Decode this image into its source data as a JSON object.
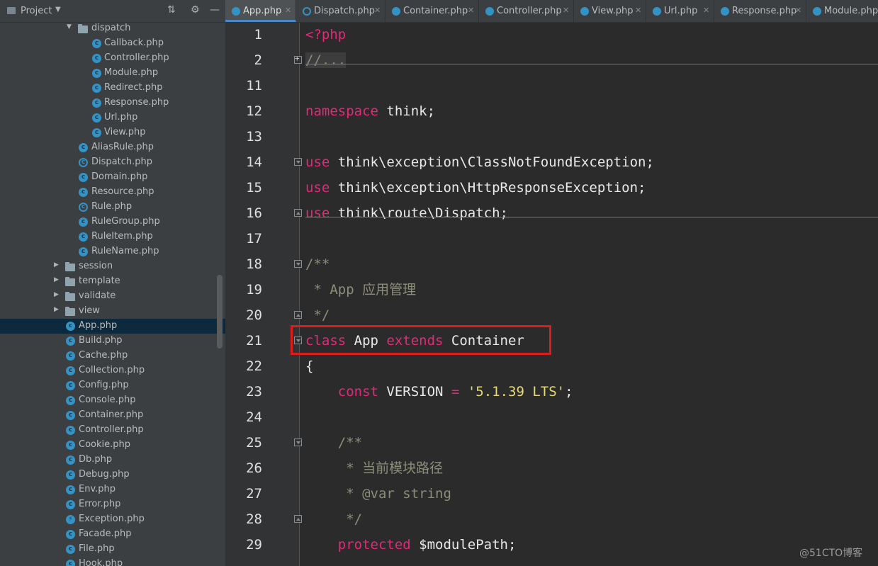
{
  "sidebar": {
    "title": "Project",
    "items": [
      {
        "label": "dispatch",
        "kind": "folder",
        "expanded": true,
        "level": 1
      },
      {
        "label": "Callback.php",
        "kind": "class",
        "level": 2
      },
      {
        "label": "Controller.php",
        "kind": "class",
        "level": 2
      },
      {
        "label": "Module.php",
        "kind": "class",
        "level": 2
      },
      {
        "label": "Redirect.php",
        "kind": "class",
        "level": 2
      },
      {
        "label": "Response.php",
        "kind": "class",
        "level": 2
      },
      {
        "label": "Url.php",
        "kind": "class",
        "level": 2
      },
      {
        "label": "View.php",
        "kind": "class",
        "level": 2
      },
      {
        "label": "AliasRule.php",
        "kind": "class",
        "level": 1
      },
      {
        "label": "Dispatch.php",
        "kind": "abstract",
        "level": 1
      },
      {
        "label": "Domain.php",
        "kind": "class",
        "level": 1
      },
      {
        "label": "Resource.php",
        "kind": "class",
        "level": 1
      },
      {
        "label": "Rule.php",
        "kind": "abstract",
        "level": 1
      },
      {
        "label": "RuleGroup.php",
        "kind": "class",
        "level": 1
      },
      {
        "label": "RuleItem.php",
        "kind": "class",
        "level": 1
      },
      {
        "label": "RuleName.php",
        "kind": "class",
        "level": 1
      },
      {
        "label": "session",
        "kind": "folder",
        "expanded": false,
        "level": 0
      },
      {
        "label": "template",
        "kind": "folder",
        "expanded": false,
        "level": 0
      },
      {
        "label": "validate",
        "kind": "folder",
        "expanded": false,
        "level": 0
      },
      {
        "label": "view",
        "kind": "folder",
        "expanded": false,
        "level": 0
      },
      {
        "label": "App.php",
        "kind": "class",
        "level": 0,
        "selected": true
      },
      {
        "label": "Build.php",
        "kind": "class",
        "level": 0
      },
      {
        "label": "Cache.php",
        "kind": "class",
        "level": 0
      },
      {
        "label": "Collection.php",
        "kind": "class",
        "level": 0
      },
      {
        "label": "Config.php",
        "kind": "class",
        "level": 0
      },
      {
        "label": "Console.php",
        "kind": "class",
        "level": 0
      },
      {
        "label": "Container.php",
        "kind": "class",
        "level": 0
      },
      {
        "label": "Controller.php",
        "kind": "class",
        "level": 0
      },
      {
        "label": "Cookie.php",
        "kind": "class",
        "level": 0
      },
      {
        "label": "Db.php",
        "kind": "class",
        "level": 0
      },
      {
        "label": "Debug.php",
        "kind": "class",
        "level": 0
      },
      {
        "label": "Env.php",
        "kind": "class",
        "level": 0
      },
      {
        "label": "Error.php",
        "kind": "class",
        "level": 0
      },
      {
        "label": "Exception.php",
        "kind": "exception",
        "level": 0
      },
      {
        "label": "Facade.php",
        "kind": "class",
        "level": 0
      },
      {
        "label": "File.php",
        "kind": "class",
        "level": 0
      },
      {
        "label": "Hook.php",
        "kind": "class",
        "level": 0
      }
    ]
  },
  "tabs": [
    {
      "label": "App.php",
      "active": true,
      "kind": "class"
    },
    {
      "label": "Dispatch.php",
      "kind": "abstract"
    },
    {
      "label": "Container.php",
      "kind": "class"
    },
    {
      "label": "Controller.php",
      "kind": "class"
    },
    {
      "label": "View.php",
      "kind": "class"
    },
    {
      "label": "Url.php",
      "kind": "class"
    },
    {
      "label": "Response.php",
      "kind": "class"
    },
    {
      "label": "Module.php",
      "kind": "class"
    }
  ],
  "editor": {
    "lines": [
      {
        "num": "1",
        "parts": [
          {
            "t": "<?php",
            "c": "tag"
          }
        ]
      },
      {
        "num": "2",
        "parts": [
          {
            "t": "//...",
            "c": "fold-txt"
          }
        ],
        "fold": "plus"
      },
      {
        "num": "11",
        "parts": [],
        "sep_after": true
      },
      {
        "num": "12",
        "parts": [
          {
            "t": "namespace",
            "c": "kw"
          },
          {
            "t": " think;",
            "c": ""
          }
        ]
      },
      {
        "num": "13",
        "parts": []
      },
      {
        "num": "14",
        "parts": [
          {
            "t": "use",
            "c": "kw"
          },
          {
            "t": " think\\exception\\ClassNotFoundException;",
            "c": ""
          }
        ],
        "fold": "open"
      },
      {
        "num": "15",
        "parts": [
          {
            "t": "use",
            "c": "kw"
          },
          {
            "t": " think\\exception\\HttpResponseException;",
            "c": ""
          }
        ]
      },
      {
        "num": "16",
        "parts": [
          {
            "t": "use",
            "c": "kw"
          },
          {
            "t": " think\\route\\Dispatch;",
            "c": ""
          }
        ],
        "fold": "close"
      },
      {
        "num": "17",
        "parts": [],
        "sep_after": true
      },
      {
        "num": "18",
        "parts": [
          {
            "t": "/**",
            "c": "cm"
          }
        ],
        "fold": "open"
      },
      {
        "num": "19",
        "parts": [
          {
            "t": " * App 应用管理",
            "c": "cm"
          }
        ]
      },
      {
        "num": "20",
        "parts": [
          {
            "t": " */",
            "c": "cm"
          }
        ],
        "fold": "close"
      },
      {
        "num": "21",
        "parts": [
          {
            "t": "class",
            "c": "kw"
          },
          {
            "t": " App ",
            "c": ""
          },
          {
            "t": "extends",
            "c": "kw"
          },
          {
            "t": " Container",
            "c": ""
          }
        ],
        "fold": "open"
      },
      {
        "num": "22",
        "parts": [
          {
            "t": "{",
            "c": ""
          }
        ]
      },
      {
        "num": "23",
        "parts": [
          {
            "t": "    ",
            "c": ""
          },
          {
            "t": "const",
            "c": "kw"
          },
          {
            "t": " VERSION ",
            "c": ""
          },
          {
            "t": "=",
            "c": "kw"
          },
          {
            "t": " ",
            "c": ""
          },
          {
            "t": "'5.1.39 LTS'",
            "c": "str"
          },
          {
            "t": ";",
            "c": ""
          }
        ]
      },
      {
        "num": "24",
        "parts": []
      },
      {
        "num": "25",
        "parts": [
          {
            "t": "    /**",
            "c": "cm"
          }
        ],
        "fold": "open"
      },
      {
        "num": "26",
        "parts": [
          {
            "t": "     * 当前模块路径",
            "c": "cm"
          }
        ]
      },
      {
        "num": "27",
        "parts": [
          {
            "t": "     * @var string",
            "c": "cm"
          }
        ]
      },
      {
        "num": "28",
        "parts": [
          {
            "t": "     */",
            "c": "cm"
          }
        ],
        "fold": "close"
      },
      {
        "num": "29",
        "parts": [
          {
            "t": "    ",
            "c": ""
          },
          {
            "t": "protected",
            "c": "kw"
          },
          {
            "t": " $modulePath;",
            "c": ""
          }
        ]
      }
    ]
  },
  "watermark": "@51CTO博客",
  "colors": {
    "keyword": "#e6287a",
    "string": "#e6db74",
    "comment": "#8c8c7a",
    "highlight_box": "#e01b1b",
    "selection": "#0d293e"
  }
}
